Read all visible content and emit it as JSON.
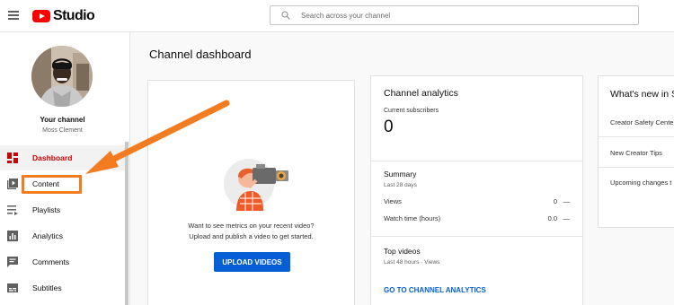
{
  "app": {
    "logo_text": "Studio",
    "brand_color": "#ff0000"
  },
  "header": {
    "search_placeholder": "Search across your channel"
  },
  "sidebar": {
    "channel_title": "Your channel",
    "channel_name": "Moss Clement",
    "items": [
      {
        "label": "Dashboard",
        "icon": "dashboard-icon",
        "active": true
      },
      {
        "label": "Content",
        "icon": "content-icon"
      },
      {
        "label": "Playlists",
        "icon": "playlists-icon"
      },
      {
        "label": "Analytics",
        "icon": "analytics-icon"
      },
      {
        "label": "Comments",
        "icon": "comments-icon"
      },
      {
        "label": "Subtitles",
        "icon": "subtitles-icon"
      }
    ]
  },
  "main": {
    "page_title": "Channel dashboard",
    "upload_card": {
      "line1": "Want to see metrics on your recent video?",
      "line2": "Upload and publish a video to get started.",
      "button": "UPLOAD VIDEOS"
    },
    "analytics_card": {
      "title": "Channel analytics",
      "subscribers_label": "Current subscribers",
      "subscribers_value": "0",
      "summary_title": "Summary",
      "summary_period": "Last 28 days",
      "rows": [
        {
          "label": "Views",
          "value": "0",
          "delta": "—"
        },
        {
          "label": "Watch time (hours)",
          "value": "0.0",
          "delta": "—"
        }
      ],
      "top_videos_title": "Top videos",
      "top_videos_period": "Last 48 hours · Views",
      "link": "GO TO CHANNEL ANALYTICS"
    },
    "news_card": {
      "title": "What's new in S",
      "items": [
        "Creator Safety Cente",
        "New Creator Tips",
        "Upcoming changes t"
      ]
    }
  },
  "annotation": {
    "color": "#f47c20"
  }
}
